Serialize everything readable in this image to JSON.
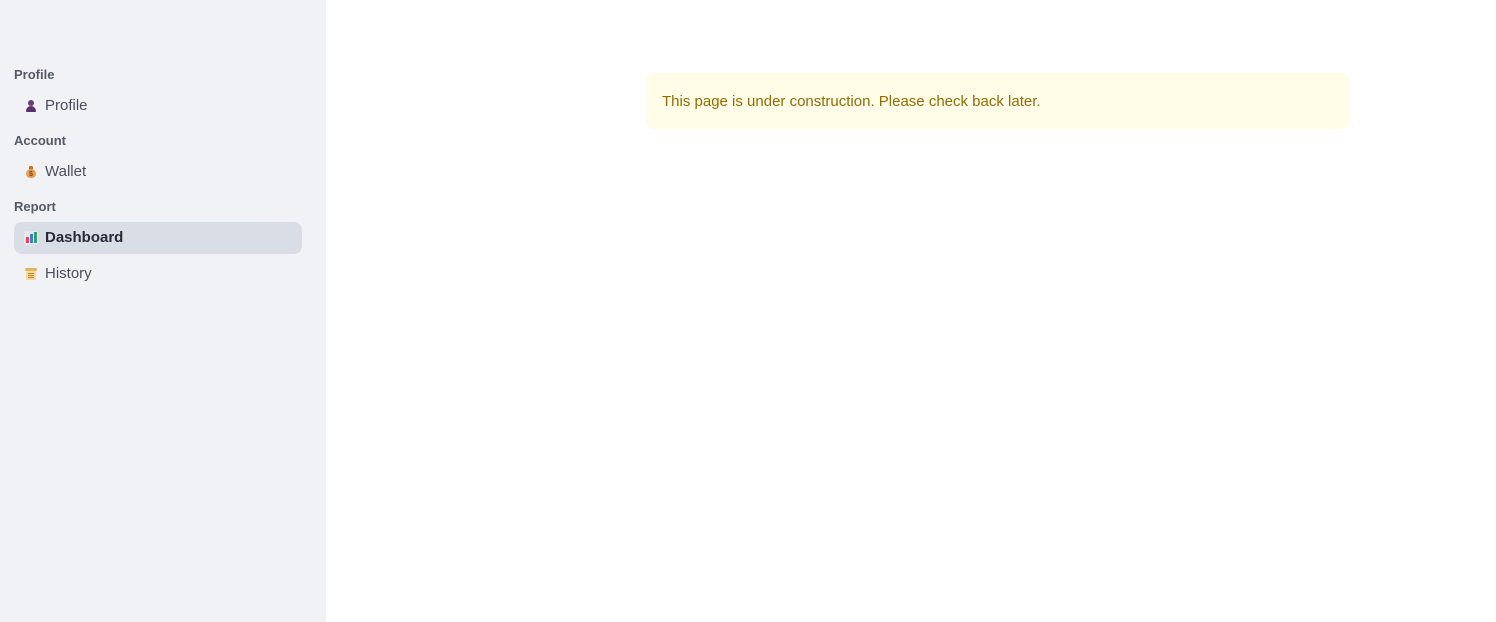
{
  "sidebar": {
    "sections": [
      {
        "header": "Profile",
        "items": [
          {
            "label": "Profile",
            "icon": "person-icon",
            "active": false
          }
        ]
      },
      {
        "header": "Account",
        "items": [
          {
            "label": "Wallet",
            "icon": "money-bag-icon",
            "active": false
          }
        ]
      },
      {
        "header": "Report",
        "items": [
          {
            "label": "Dashboard",
            "icon": "bar-chart-icon",
            "active": true
          },
          {
            "label": "History",
            "icon": "scroll-icon",
            "active": false
          }
        ]
      }
    ]
  },
  "main": {
    "alert": {
      "text": "This page is under construction. Please check back later.",
      "type": "warning",
      "background": "#fffce7",
      "text_color": "#926c05"
    }
  },
  "colors": {
    "sidebar_bg": "#f0f2f6",
    "active_item_bg": "#d9dde6"
  }
}
